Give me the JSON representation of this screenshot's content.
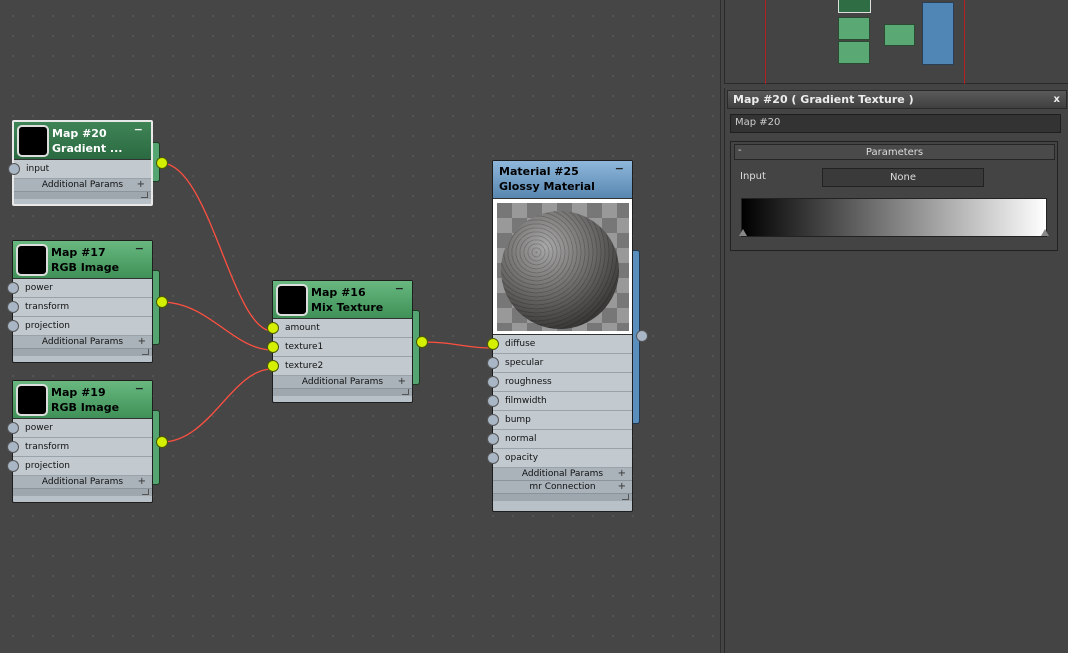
{
  "nodes": {
    "map20": {
      "id": "Map #20",
      "type": "Gradient ...",
      "params": [
        "input"
      ],
      "additional": "Additional Params"
    },
    "map17": {
      "id": "Map #17",
      "type": "RGB Image",
      "params": [
        "power",
        "transform",
        "projection"
      ],
      "additional": "Additional Params"
    },
    "map19": {
      "id": "Map #19",
      "type": "RGB Image",
      "params": [
        "power",
        "transform",
        "projection"
      ],
      "additional": "Additional Params"
    },
    "map16": {
      "id": "Map #16",
      "type": "Mix Texture",
      "params": [
        "amount",
        "texture1",
        "texture2"
      ],
      "additional": "Additional Params"
    },
    "mat25": {
      "id": "Material #25",
      "type": "Glossy Material",
      "params": [
        "diffuse",
        "specular",
        "roughness",
        "filmwidth",
        "bump",
        "normal",
        "opacity"
      ],
      "additional": "Additional Params",
      "connection": "mr Connection"
    }
  },
  "icons": {
    "collapse": "−",
    "expand": "+",
    "close": "x",
    "rollout_collapse": "-"
  },
  "panel": {
    "title": "Map #20  ( Gradient Texture )",
    "name_value": "Map #20",
    "rollout_title": "Parameters",
    "input_label": "Input",
    "input_button": "None"
  },
  "colors": {
    "map_header": "#5aa874",
    "selected_header": "#2f6e45",
    "material_header": "#6f9cc6",
    "wire": "#ff5040",
    "socket_on": "#d4f000",
    "socket_off": "#a9b6c6"
  }
}
